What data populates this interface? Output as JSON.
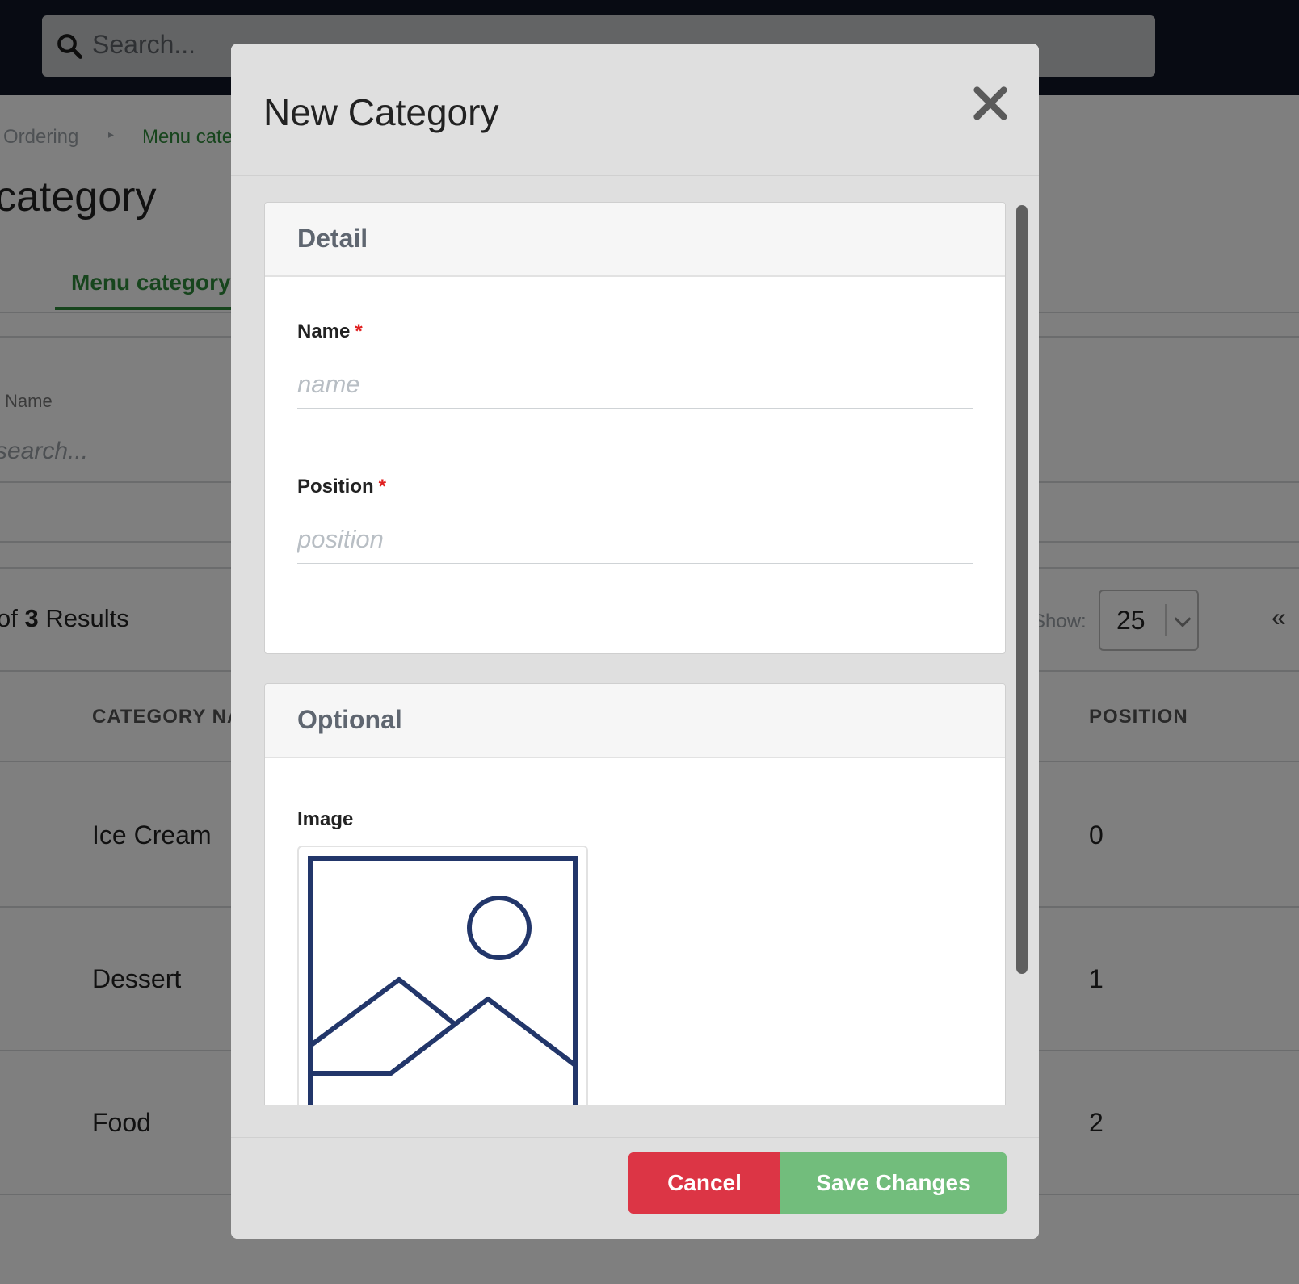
{
  "search": {
    "placeholder": "Search..."
  },
  "breadcrumb": {
    "items": [
      "Ordering",
      "Menu cate"
    ],
    "separator": "▸"
  },
  "page": {
    "title": "category",
    "tab_label": "Menu category"
  },
  "filter": {
    "label": "Name",
    "placeholder": "search..."
  },
  "results": {
    "prefix": "of",
    "count": "3",
    "suffix": "Results"
  },
  "pagination": {
    "show_label": "Show:",
    "page_size": "25",
    "prev_icon": "«"
  },
  "table": {
    "headers": {
      "name": "CATEGORY NA",
      "position": "POSITION"
    },
    "rows": [
      {
        "name": "Ice Cream",
        "position": "0"
      },
      {
        "name": "Dessert",
        "position": "1"
      },
      {
        "name": "Food",
        "position": "2"
      }
    ]
  },
  "modal": {
    "title": "New Category",
    "detail": {
      "header": "Detail",
      "name_label": "Name",
      "name_placeholder": "name",
      "position_label": "Position",
      "position_placeholder": "position",
      "required_mark": "*"
    },
    "optional": {
      "header": "Optional",
      "image_label": "Image",
      "image_icon": "image-placeholder-icon"
    },
    "cancel_label": "Cancel",
    "save_label": "Save Changes"
  },
  "colors": {
    "brand_green": "#2e8b3a",
    "cancel_red": "#dc3545",
    "save_green": "#72bd7c",
    "required_red": "#e02020",
    "image_icon_stroke": "#22366a"
  }
}
